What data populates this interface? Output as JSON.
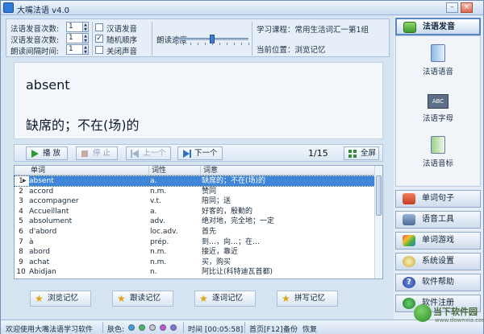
{
  "window": {
    "title": "大嘴法语 v4.0",
    "minimize": "–",
    "close": "×"
  },
  "controls": {
    "play_count_fr": {
      "label": "法语发音次数:",
      "value": "1"
    },
    "play_count_cn": {
      "label": "汉语发音次数:",
      "value": "1"
    },
    "interval": {
      "label": "朗读间隔时间:",
      "value": "1"
    },
    "spin_arrows": {
      "up": "▲",
      "down": "▼"
    },
    "chk_cn": {
      "label": "汉语发音",
      "checked": false
    },
    "chk_random": {
      "label": "随机顺序",
      "checked": true
    },
    "chk_mute": {
      "label": "关闭声音",
      "checked": false
    },
    "check_mark": "✓",
    "speed_label": "朗读速度",
    "speed_level": 0.5,
    "course": "学习课程：常用生活词汇一第1组",
    "position": "当前位置：浏览记忆"
  },
  "display": {
    "word": "absent",
    "meaning": "缺席的；不在(场)的"
  },
  "toolbar": {
    "play": "播 放",
    "stop": "停 止",
    "prev": "上一个",
    "next": "下一个",
    "counter": "1/15",
    "fullscreen": "全屏"
  },
  "list": {
    "headers": {
      "word": "单词",
      "pos": "词性",
      "meaning": "词意"
    },
    "rows": [
      {
        "n": "1",
        "word": "absent",
        "pos": "a.",
        "meaning": "缺席的；不在(场)的",
        "selected": true,
        "marker": "▶"
      },
      {
        "n": "2",
        "word": "accord",
        "pos": "n.m.",
        "meaning": "赞同"
      },
      {
        "n": "3",
        "word": "accompagner",
        "pos": "v.t.",
        "meaning": "陪同；送"
      },
      {
        "n": "4",
        "word": "Accueillant",
        "pos": "a.",
        "meaning": "好客的，殷勤的"
      },
      {
        "n": "5",
        "word": "absolument",
        "pos": "adv.",
        "meaning": "绝对地，完全地；一定"
      },
      {
        "n": "6",
        "word": "d'abord",
        "pos": "loc.adv.",
        "meaning": "首先"
      },
      {
        "n": "7",
        "word": "à",
        "pos": "prép.",
        "meaning": "到…，向…；在…"
      },
      {
        "n": "8",
        "word": "abord",
        "pos": "n.m.",
        "meaning": "接近，靠近"
      },
      {
        "n": "9",
        "word": "achat",
        "pos": "n.m.",
        "meaning": "买，购买"
      },
      {
        "n": "10",
        "word": "Abidjan",
        "pos": "n.",
        "meaning": "阿比让(科特迪瓦首都)"
      }
    ]
  },
  "memory_buttons": {
    "browse": "浏览记忆",
    "follow": "跟读记忆",
    "word": "逐词记忆",
    "spell": "拼写记忆"
  },
  "sidebar": {
    "top": "法语发音",
    "items": [
      "法语语音",
      "法语字母",
      "法语音标"
    ],
    "bottom": [
      "单词句子",
      "语音工具",
      "单词游戏",
      "系统设置",
      "软件帮助",
      "软件注册"
    ]
  },
  "status": {
    "welcome": "欢迎使用大嘴法语学习软件",
    "skin": "肤色:",
    "time": "时间 [00:05:58]",
    "home": "首页[F12]",
    "back": "备份",
    "restore": "恢复",
    "skin_colors": [
      "#3aa0e0",
      "#3fbf55",
      "#c9c9c9",
      "#d050d0",
      "#8a6fe0"
    ]
  },
  "watermark": {
    "text": "当下软件园",
    "sub": "www.downxia.com"
  },
  "colors": {
    "accent": "#3f86d8",
    "panel": "#d6e3f1"
  }
}
